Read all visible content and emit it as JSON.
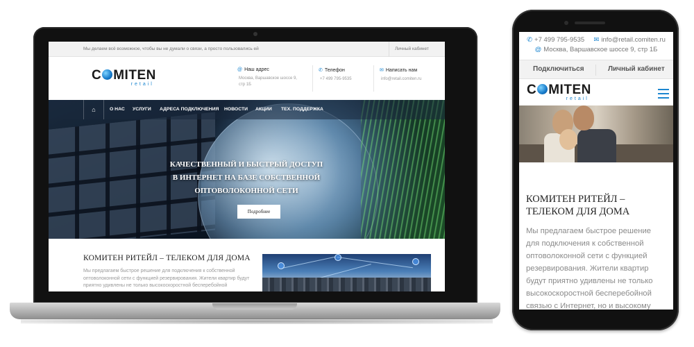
{
  "laptop": {
    "topbar": {
      "message": "Мы делаем всё возможное, чтобы вы не думали о связи, а просто пользовались ей",
      "cabinet": "Личный кабинет"
    },
    "logo": {
      "main_pre": "C",
      "main_post": "MITEN",
      "sub": "retail"
    },
    "contacts": [
      {
        "icon": "@",
        "title": "Наш адрес",
        "value": "Москва, Варшавское шоссе 9, стр 1Б"
      },
      {
        "icon": "✆",
        "title": "Телефон",
        "value": "+7 499 795-9535"
      },
      {
        "icon": "✉",
        "title": "Написать нам",
        "value": "info@retail.comiten.ru"
      }
    ],
    "nav": [
      "О НАС",
      "УСЛУГИ",
      "АДРЕСА ПОДКЛЮЧЕНИЯ",
      "НОВОСТИ",
      "АКЦИИ",
      "ТЕХ. ПОДДЕРЖКА"
    ],
    "home_icon": "⌂",
    "hero": {
      "title": "КАЧЕСТВЕННЫЙ И БЫСТРЫЙ ДОСТУП В ИНТЕРНЕТ НА БАЗЕ СОБСТВЕННОЙ ОПТОВОЛОКОННОЙ СЕТИ",
      "button": "Подробнее"
    },
    "section": {
      "title": "КОМИТЕН РИТЕЙЛ – ТЕЛЕКОМ ДЛЯ ДОМА",
      "text": "Мы предлагаем быстрое решение для подключения к собственной оптоволоконной сети с функцией резервирования. Жители квартир будут приятно удивлены не только высокоскоростной бесперебойной"
    }
  },
  "phone": {
    "phone_number": "+7 499 795-9535",
    "email": "info@retail.comiten.ru",
    "address": "Москва, Варшавское шоссе 9, стр 1Б",
    "tabs": [
      "Подключиться",
      "Личный кабинет"
    ],
    "logo": {
      "main_pre": "C",
      "main_post": "MITEN",
      "sub": "retail"
    },
    "section": {
      "title": "КОМИТЕН РИТЕЙЛ – ТЕЛЕКОМ ДЛЯ ДОМА",
      "text": "Мы предлагаем быстрое решение для подключения к собственной оптоволоконной сети с функцией резервирования. Жители квартир будут приятно удивлены не только высокоскоростной бесперебойной связью с Интернет, но и высокому качеству более сотни телеканалов IPTV, которые можно"
    }
  },
  "colors": {
    "accent": "#1c86d0",
    "nav_overlay": "#19283c",
    "text_muted": "#999999"
  }
}
